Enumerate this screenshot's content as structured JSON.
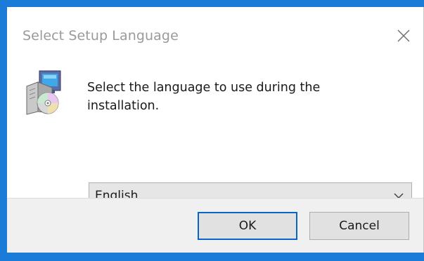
{
  "window": {
    "title": "Select Setup Language",
    "close_icon": "close-icon"
  },
  "content": {
    "icon": "setup-disc-icon",
    "message": "Select the language to use during the installation."
  },
  "language_select": {
    "value": "English",
    "arrow_icon": "chevron-down-icon"
  },
  "buttons": {
    "ok_label": "OK",
    "cancel_label": "Cancel"
  },
  "colors": {
    "desktop": "#1a7bd9",
    "default_button_border": "#0a64c8",
    "footer": "#f0f0f0"
  }
}
